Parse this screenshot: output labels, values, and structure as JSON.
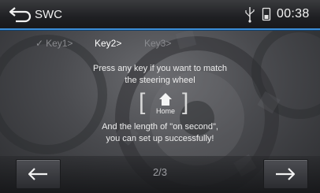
{
  "header": {
    "title": "SWC",
    "clock": "00:38",
    "icons": [
      "back-arrow-icon",
      "usb-icon",
      "phone-battery-icon"
    ]
  },
  "tabs": [
    {
      "label": "Key1>",
      "state": "done"
    },
    {
      "label": "Key2>",
      "state": "active"
    },
    {
      "label": "Key3>",
      "state": "pending"
    }
  ],
  "instructions": {
    "line1": "Press any key if you want to match",
    "line2": "the steering wheel",
    "key_label": "Home",
    "line3": "And the length of \"on second\",",
    "line4": "you can set up successfully!"
  },
  "footer": {
    "page": "2/3",
    "prev_icon": "arrow-left-icon",
    "next_icon": "arrow-right-icon"
  },
  "colors": {
    "accent": "#3d8ed6",
    "background": "#4a4b4f"
  }
}
